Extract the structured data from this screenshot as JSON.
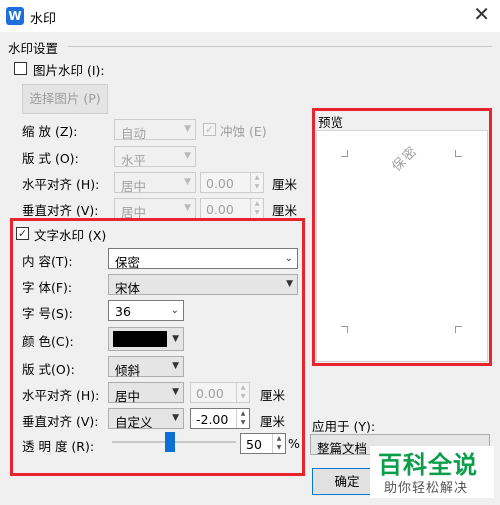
{
  "window": {
    "title": "水印",
    "close_glyph": "✕"
  },
  "group_title": "水印设置",
  "picture": {
    "checkbox_label": "图片水印 (I):",
    "select_button": "选择图片 (P)",
    "scale_label": "缩   放 (Z):",
    "scale_value": "自动",
    "washout_label": "冲蚀 (E)",
    "layout_label": "版   式 (O):",
    "layout_value": "水平",
    "halign_label": "水平对齐 (H):",
    "halign_value": "居中",
    "halign_offset": "0.00",
    "valign_label": "垂直对齐 (V):",
    "valign_value": "居中",
    "valign_offset": "0.00",
    "unit": "厘米"
  },
  "text": {
    "checkbox_label": "文字水印 (X)",
    "content_label": "内   容(T):",
    "content_value": "保密",
    "font_label": "字   体(F):",
    "font_value": "宋体",
    "size_label": "字   号(S):",
    "size_value": "36",
    "color_label": "颜   色(C):",
    "color_value": "#000000",
    "layout_label": "版   式(O):",
    "layout_value": "倾斜",
    "halign_label": "水平对齐 (H):",
    "halign_value": "居中",
    "halign_offset": "0.00",
    "valign_label": "垂直对齐 (V):",
    "valign_value": "自定义",
    "valign_offset": "-2.00",
    "unit": "厘米",
    "transparency_label": "透 明 度 (R):",
    "transparency_value": "50",
    "percent": "%"
  },
  "preview": {
    "title": "预览",
    "watermark_text": "保密"
  },
  "apply": {
    "label": "应用于 (Y):",
    "value": "整篇文档"
  },
  "buttons": {
    "ok": "确定"
  },
  "site_badge": {
    "top": "百科全说",
    "bottom": "助你轻松解决"
  },
  "colors": {
    "highlight": "#e8242c",
    "accent": "#0b6fd3",
    "badge_green": "#0b9e4a"
  }
}
